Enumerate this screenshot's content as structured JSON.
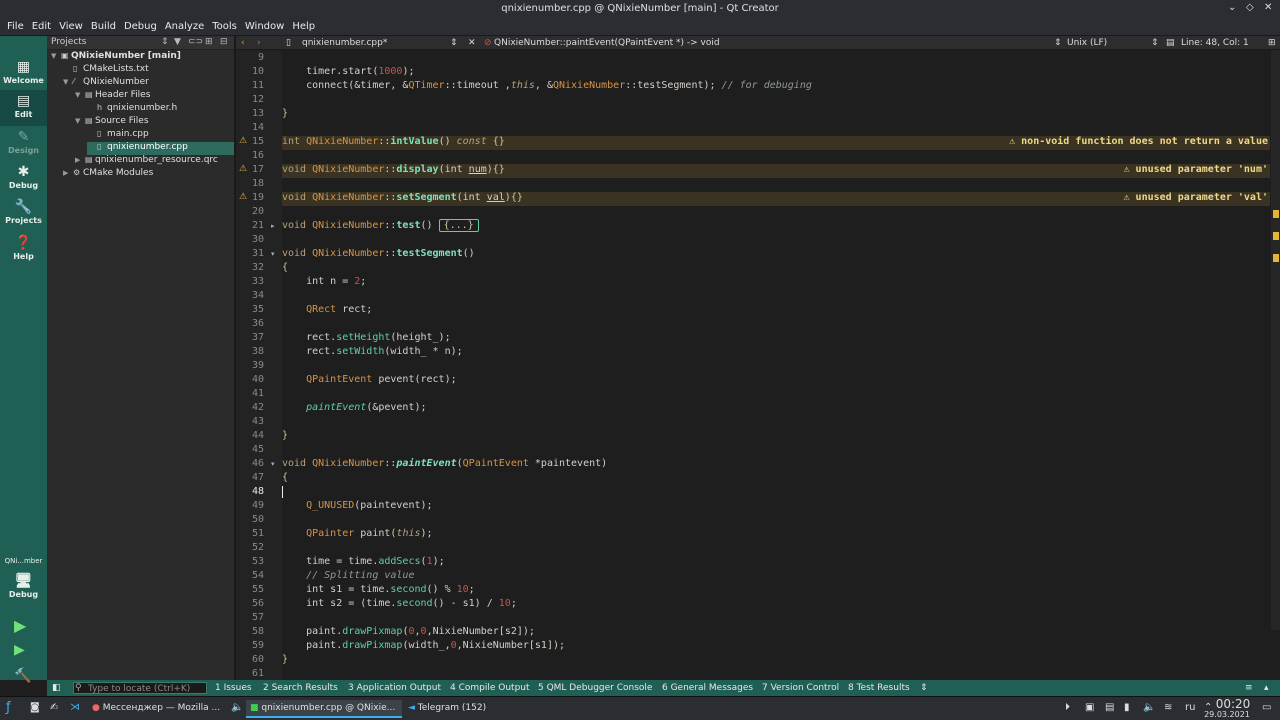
{
  "window": {
    "title": "qnixienumber.cpp @ QNixieNumber [main] - Qt Creator"
  },
  "menu": [
    "File",
    "Edit",
    "View",
    "Build",
    "Debug",
    "Analyze",
    "Tools",
    "Window",
    "Help"
  ],
  "modes": [
    {
      "label": "Welcome",
      "icon": "grid-icon"
    },
    {
      "label": "Edit",
      "icon": "edit-icon"
    },
    {
      "label": "Design",
      "icon": "pen-icon"
    },
    {
      "label": "Debug",
      "icon": "bug-icon"
    },
    {
      "label": "Projects",
      "icon": "wrench-icon"
    },
    {
      "label": "Help",
      "icon": "help-icon"
    }
  ],
  "kit": {
    "name": "QNi...mber",
    "mode": "Debug"
  },
  "projects": {
    "header": "Projects",
    "tree": [
      {
        "label": "QNixieNumber [main]",
        "bold": true
      },
      {
        "label": "CMakeLists.txt"
      },
      {
        "label": "QNixieNumber"
      },
      {
        "label": "Header Files"
      },
      {
        "label": "qnixienumber.h"
      },
      {
        "label": "Source Files"
      },
      {
        "label": "main.cpp"
      },
      {
        "label": "qnixienumber.cpp",
        "selected": true
      },
      {
        "label": "qnixienumber_resource.qrc"
      },
      {
        "label": "CMake Modules"
      }
    ]
  },
  "editor": {
    "file": "qnixienumber.cpp*",
    "symbol": "QNixieNumber::paintEvent(QPaintEvent *) -> void",
    "line_ending": "Unix (LF)",
    "position": "Line: 48, Col: 1"
  },
  "lines": [
    "9",
    "10",
    "11",
    "12",
    "13",
    "14",
    "15",
    "16",
    "17",
    "18",
    "19",
    "20",
    "21",
    "30",
    "31",
    "32",
    "33",
    "34",
    "35",
    "36",
    "37",
    "38",
    "39",
    "40",
    "41",
    "42",
    "43",
    "44",
    "45",
    "46",
    "47",
    "48",
    "49",
    "50",
    "51",
    "52",
    "53",
    "54",
    "55",
    "56",
    "57",
    "58",
    "59",
    "60",
    "61"
  ],
  "warnings": [
    {
      "line": "15",
      "text": "non-void function does not return a value"
    },
    {
      "line": "17",
      "text": "unused parameter 'num'"
    },
    {
      "line": "19",
      "text": "unused parameter 'val'"
    }
  ],
  "code": {
    "l10a": "timer.start(",
    "l10b": "1000",
    "l10c": ");",
    "l11a": "connect(&timer, &",
    "l11b": "QTimer",
    "l11c": "::timeout ,",
    "l11d": "this",
    "l11e": ", &",
    "l11f": "QNixieNumber",
    "l11g": "::testSegment); ",
    "l11h": "// for debuging",
    "l13": "}",
    "l15a": "int ",
    "l15b": "QNixieNumber",
    "l15c": "::",
    "l15d": "intValue",
    "l15e": "() ",
    "l15f": "const",
    "l15g": " {}",
    "l17a": "void ",
    "l17b": "QNixieNumber",
    "l17c": "::",
    "l17d": "display",
    "l17e": "(int ",
    "l17f": "num",
    "l17g": "){}",
    "l19a": "void ",
    "l19b": "QNixieNumber",
    "l19c": "::",
    "l19d": "setSegment",
    "l19e": "(int ",
    "l19f": "val",
    "l19g": "){}",
    "l21a": "void ",
    "l21b": "QNixieNumber",
    "l21c": "::",
    "l21d": "test",
    "l21e": "() ",
    "l21f": "{...}",
    "l31a": "void ",
    "l31b": "QNixieNumber",
    "l31c": "::",
    "l31d": "testSegment",
    "l31e": "()",
    "l32": "{",
    "l33a": "int n = ",
    "l33b": "2",
    "l33c": ";",
    "l35a": "QRect",
    "l35b": " rect;",
    "l37a": "rect.",
    "l37b": "setHeight",
    "l37c": "(height_);",
    "l38a": "rect.",
    "l38b": "setWidth",
    "l38c": "(width_ * n);",
    "l40a": "QPaintEvent",
    "l40b": " pevent(rect);",
    "l42a": "paintEvent",
    "l42b": "(&pevent);",
    "l44": "}",
    "l46a": "void ",
    "l46b": "QNixieNumber",
    "l46c": "::",
    "l46d": "paintEvent",
    "l46e": "(",
    "l46f": "QPaintEvent",
    "l46g": " *paintevent)",
    "l47": "{",
    "l49a": "Q_UNUSED",
    "l49b": "(paintevent);",
    "l51a": "QPainter",
    "l51b": " paint(",
    "l51c": "this",
    "l51d": ");",
    "l53a": "time = time.",
    "l53b": "addSecs",
    "l53c": "(",
    "l53d": "1",
    "l53e": ");",
    "l54": "// Splitting value",
    "l55a": "int s1 = time.",
    "l55b": "second",
    "l55c": "() % ",
    "l55d": "10",
    "l55e": ";",
    "l56a": "int s2 = (time.",
    "l56b": "second",
    "l56c": "() - s1) / ",
    "l56d": "10",
    "l56e": ";",
    "l58a": "paint.",
    "l58b": "drawPixmap",
    "l58c": "(",
    "l58d": "0",
    "l58e": ",",
    "l58f": "0",
    "l58g": ",NixieNumber[s2]);",
    "l59a": "paint.",
    "l59b": "drawPixmap",
    "l59c": "(width_,",
    "l59d": "0",
    "l59e": ",NixieNumber[s1]);",
    "l60": "}"
  },
  "output_panes": {
    "locate_placeholder": "Type to locate (Ctrl+K)",
    "tabs": [
      "1  Issues",
      "2  Search Results",
      "3  Application Output",
      "4  Compile Output",
      "5  QML Debugger Console",
      "6  General Messages",
      "7  Version Control",
      "8  Test Results"
    ]
  },
  "taskbar": {
    "items": [
      {
        "label": "Мессенджер — Mozilla ...",
        "icon": "firefox-icon"
      },
      {
        "label": "qnixienumber.cpp @ QNixie...",
        "icon": "qtcreator-icon",
        "active": true
      },
      {
        "label": "Telegram (152)",
        "icon": "telegram-icon"
      }
    ],
    "lang": "ru",
    "time": "00:20",
    "date": "29.03.2021"
  },
  "colors": {
    "modebar": "#1f5f54",
    "selection": "#2e6b5f",
    "warning": "#e5b53a"
  }
}
